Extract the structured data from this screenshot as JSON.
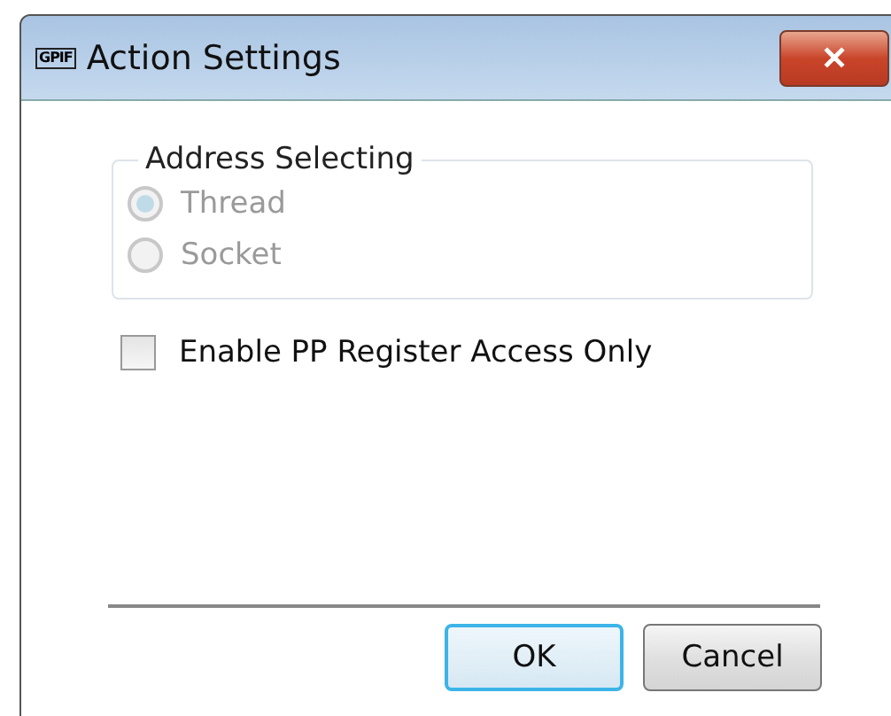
{
  "window": {
    "icon_label": "GPIF",
    "title": "Action Settings",
    "close": "✕"
  },
  "address_group": {
    "legend": "Address Selecting",
    "disabled": true,
    "options": [
      {
        "label": "Thread",
        "selected": true
      },
      {
        "label": "Socket",
        "selected": false
      }
    ]
  },
  "checkbox": {
    "label": "Enable PP Register Access Only",
    "checked": false
  },
  "buttons": [
    {
      "label": "OK",
      "default": true
    },
    {
      "label": "Cancel",
      "default": false
    }
  ]
}
